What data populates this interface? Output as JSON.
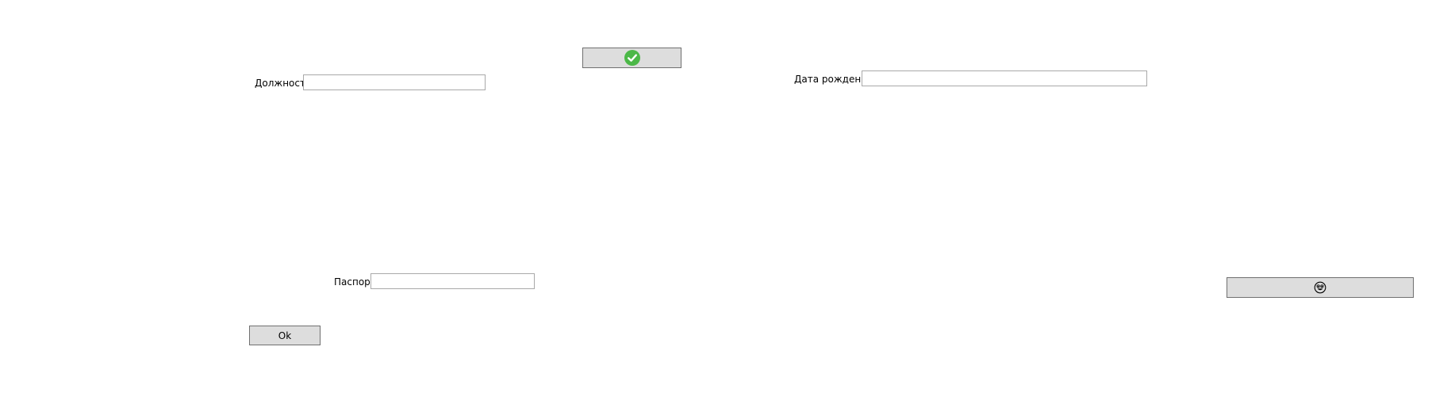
{
  "form": {
    "position_label": "Должность",
    "position_value": "",
    "birthdate_label": "Дата рождения",
    "birthdate_value": "",
    "passport_label": "Паспорт",
    "passport_value": "",
    "ok_button_label": "Ok"
  },
  "buttons": {
    "confirm_icon": "green-checkmark-icon",
    "emoji_icon": "smiley-face-icon"
  },
  "colors": {
    "button_bg": "#dddddd",
    "button_border": "#707070",
    "field_border": "#a9a9a9",
    "check_green": "#4cb848"
  }
}
